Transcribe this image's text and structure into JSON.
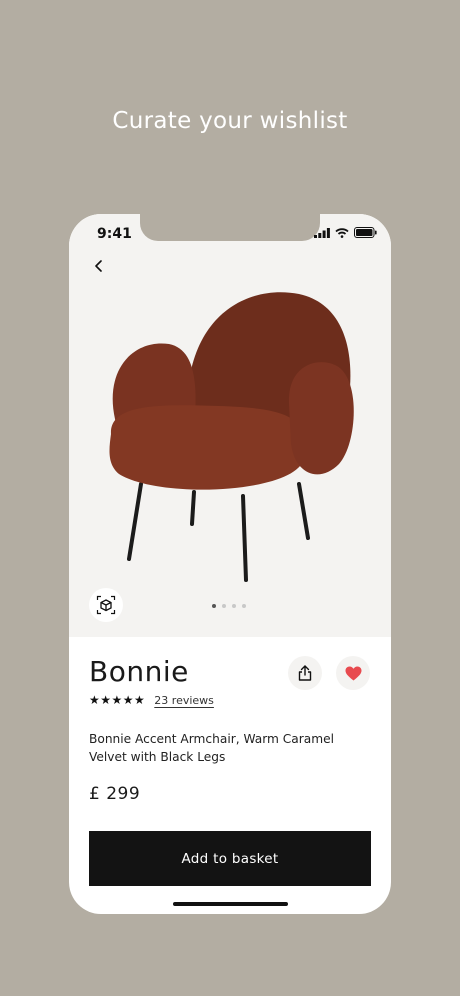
{
  "headline": "Curate your wishlist",
  "status_bar": {
    "time": "9:41",
    "icons": [
      "signal-icon",
      "wifi-icon",
      "battery-icon"
    ]
  },
  "product": {
    "name": "Bonnie",
    "rating_stars": 5,
    "stars_text": "★★★★★",
    "reviews_text": "23 reviews",
    "description": "Bonnie Accent Armchair, Warm Caramel Velvet with Black Legs",
    "price": "£ 299",
    "image": {
      "subject": "armchair",
      "color": "#7a3321",
      "carousel_total": 4,
      "carousel_active": 0
    }
  },
  "actions": {
    "add_to_basket": "Add to basket",
    "back": "back-icon",
    "ar_view": "ar-view-icon",
    "share": "share-icon",
    "favourite": "heart-icon"
  },
  "colors": {
    "background": "#b3ada2",
    "heart": "#e84a4f",
    "button": "#131313"
  }
}
